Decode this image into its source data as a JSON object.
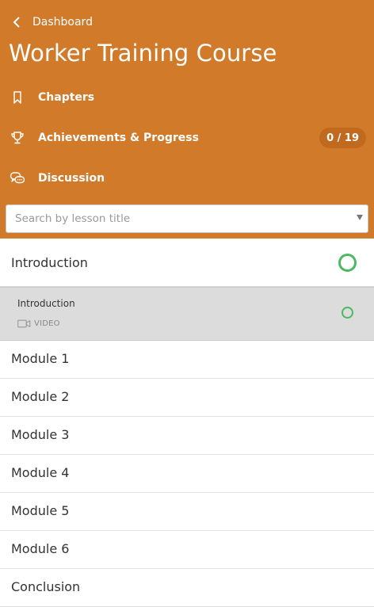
{
  "header": {
    "back_label": "Dashboard",
    "course_title": "Worker Training Course",
    "background_color": "#d17a29"
  },
  "nav": {
    "chapters": {
      "label": "Chapters",
      "icon": "bookmark-icon"
    },
    "achievements": {
      "label": "Achievements & Progress",
      "icon": "trophy-icon",
      "badge": "0 / 19"
    },
    "discussion": {
      "label": "Discussion",
      "icon": "chat-bubbles-icon"
    }
  },
  "search": {
    "placeholder": "Search by lesson title",
    "icon": "caret-down-icon"
  },
  "chapters": [
    {
      "label": "Introduction",
      "expanded": true,
      "status_icon": "progress-ring-icon"
    },
    {
      "label": "Module 1"
    },
    {
      "label": "Module 2"
    },
    {
      "label": "Module 3"
    },
    {
      "label": "Module 4"
    },
    {
      "label": "Module 5"
    },
    {
      "label": "Module 6"
    },
    {
      "label": "Conclusion"
    }
  ],
  "lessons": [
    {
      "title": "Introduction",
      "type": "VIDEO",
      "type_icon": "video-camera-icon",
      "status_icon": "progress-ring-icon"
    }
  ],
  "colors": {
    "accent": "#d17a29",
    "complete_ring": "#4bb95f",
    "selected_lesson_bg": "#dcdcdc"
  }
}
